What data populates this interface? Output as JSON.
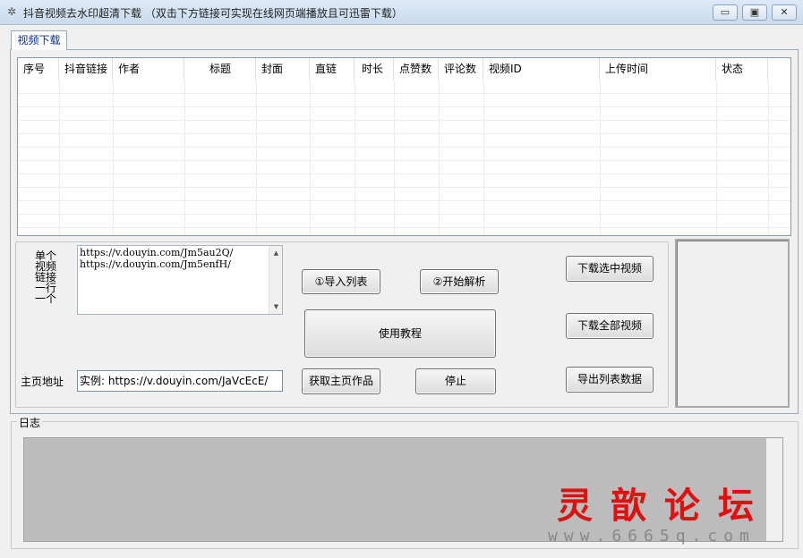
{
  "window": {
    "title": "抖音视频去水印超清下载  （双击下方链接可实现在线网页端播放且可迅雷下载）",
    "icon": "gear-icon",
    "controls": {
      "minimize": "▭",
      "maximize": "▣",
      "close": "✕"
    }
  },
  "tabs": [
    {
      "label": "视频下载",
      "active": true
    }
  ],
  "table": {
    "columns": [
      "序号",
      "抖音链接",
      "作者",
      "标题",
      "封面",
      "直链",
      "时长",
      "点赞数",
      "评论数",
      "视频ID",
      "上传时间",
      "状态"
    ],
    "rows": []
  },
  "input_section": {
    "link_label": "单个视频链接一行一个",
    "link_label_lines": [
      "单个",
      "视频",
      "链接",
      "一行",
      "一个"
    ],
    "links_text": "https://v.douyin.com/Jm5au2Q/\nhttps://v.douyin.com/Jm5enfH/",
    "homepage_label": "主页地址",
    "homepage_value": "实例: https://v.douyin.com/JaVcEcE/"
  },
  "buttons": {
    "import_list": "①导入列表",
    "start_parse": "②开始解析",
    "tutorial": "使用教程",
    "get_homepage": "获取主页作品",
    "stop": "停止",
    "download_selected": "下载选中视频",
    "download_all": "下载全部视频",
    "export_list": "导出列表数据"
  },
  "log": {
    "label": "日志"
  },
  "watermark": {
    "line1": "灵歆论坛",
    "line2": "www.6665q.com"
  }
}
